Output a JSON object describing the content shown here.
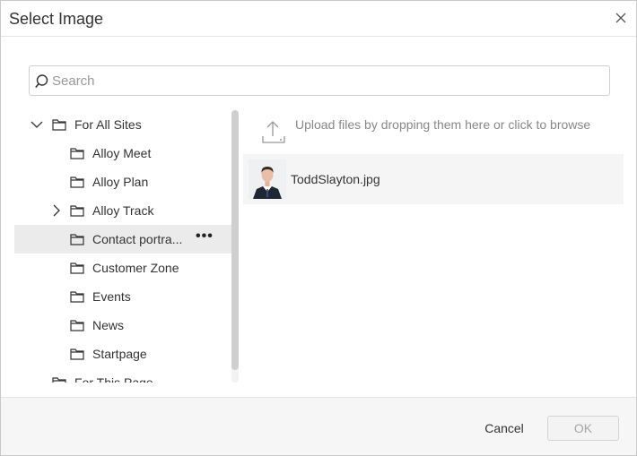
{
  "dialog": {
    "title": "Select Image"
  },
  "search": {
    "placeholder": "Search",
    "value": ""
  },
  "tree": {
    "items": [
      {
        "label": "For All Sites",
        "expanded": true
      },
      {
        "label": "Alloy Meet"
      },
      {
        "label": "Alloy Plan"
      },
      {
        "label": "Alloy Track",
        "collapsed": true
      },
      {
        "label": "Contact portra...",
        "selected": true,
        "more": "•••"
      },
      {
        "label": "Customer Zone"
      },
      {
        "label": "Events"
      },
      {
        "label": "News"
      },
      {
        "label": "Startpage"
      },
      {
        "label": "For This Page"
      }
    ]
  },
  "upload": {
    "text": "Upload files by dropping them here or click to browse"
  },
  "files": [
    {
      "name": "ToddSlayton.jpg"
    }
  ],
  "footer": {
    "cancel_label": "Cancel",
    "ok_label": "OK"
  },
  "icons": {
    "close": "close-icon",
    "search": "search-icon",
    "folder": "folder-icon",
    "chevron_down": "chevron-down-icon",
    "chevron_right": "chevron-right-icon",
    "upload": "upload-icon",
    "more": "more-icon"
  },
  "colors": {
    "selected_row": "#ebebeb",
    "file_row": "#f5f5f5",
    "footer_bg": "#f6f6f6"
  }
}
